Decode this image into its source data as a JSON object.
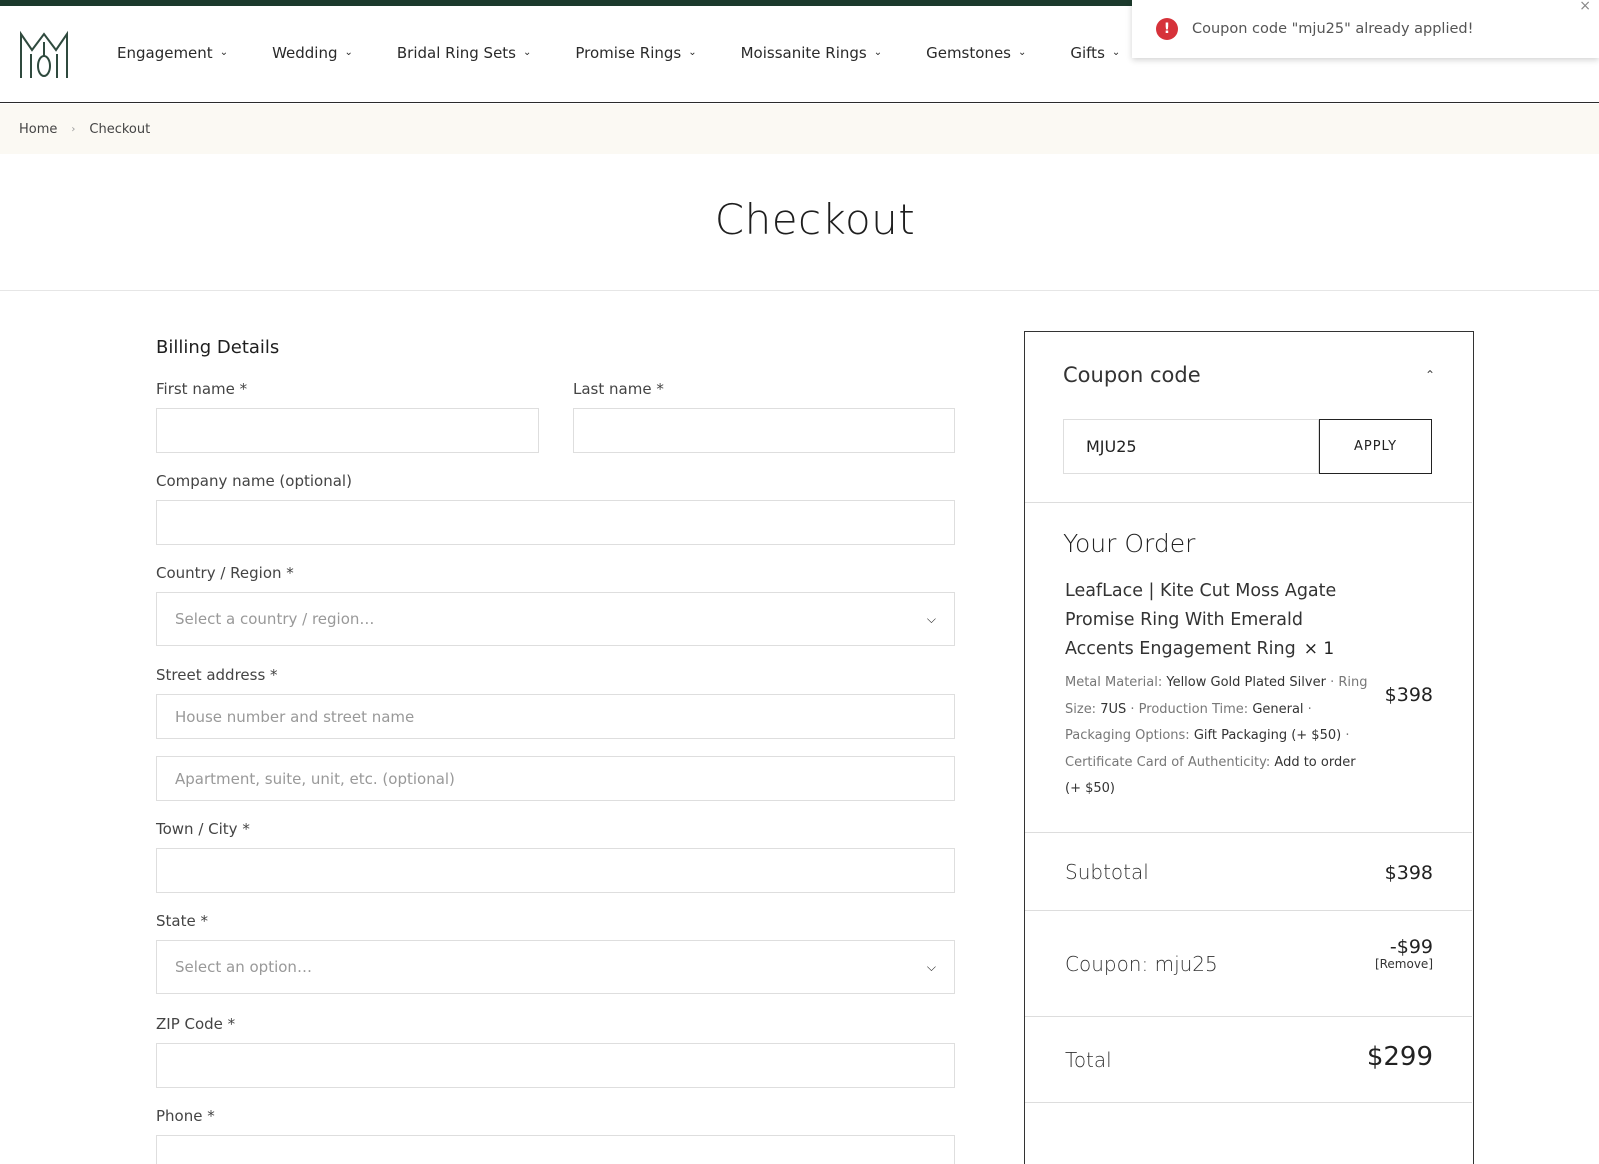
{
  "header": {
    "logo_alt": "MM",
    "nav": [
      {
        "label": "Engagement"
      },
      {
        "label": "Wedding"
      },
      {
        "label": "Bridal Ring Sets"
      },
      {
        "label": "Promise Rings"
      },
      {
        "label": "Moissanite Rings"
      },
      {
        "label": "Gemstones"
      },
      {
        "label": "Gifts"
      }
    ]
  },
  "toast": {
    "message": "Coupon code \"mju25\" already applied!",
    "icon": "!"
  },
  "breadcrumb": {
    "home": "Home",
    "current": "Checkout"
  },
  "page_title": "Checkout",
  "billing": {
    "heading": "Billing Details",
    "first_name_label": "First name *",
    "last_name_label": "Last name *",
    "company_label": "Company name (optional)",
    "country_label": "Country / Region *",
    "country_placeholder": "Select a country / region…",
    "street_label": "Street address *",
    "street_placeholder": "House number and street name",
    "apartment_placeholder": "Apartment, suite, unit, etc. (optional)",
    "city_label": "Town / City *",
    "state_label": "State *",
    "state_placeholder": "Select an option…",
    "zip_label": "ZIP Code *",
    "phone_label": "Phone *"
  },
  "summary": {
    "coupon_heading": "Coupon code",
    "coupon_value": "MJU25",
    "apply_label": "APPLY",
    "order_heading": "Your Order",
    "product": {
      "name": "LeafLace | Kite Cut Moss Agate Promise Ring With Emerald Accents Engagement Ring",
      "qty": "× 1",
      "price": "$398",
      "metal_label": "Metal Material:",
      "metal_value": "Yellow Gold Plated Silver",
      "size_label": "Ring Size:",
      "size_value": "7US",
      "production_label": "Production Time:",
      "production_value": "General",
      "packaging_label": "Packaging Options:",
      "packaging_value": "Gift Packaging (+ $50)",
      "certificate_label": "Certificate Card of Authenticity:",
      "certificate_value": "Add to order (+ $50)"
    },
    "subtotal_label": "Subtotal",
    "subtotal_value": "$398",
    "coupon_label": "Coupon: mju25",
    "coupon_discount": "-$99",
    "remove_label": "[Remove]",
    "total_label": "Total",
    "total_value": "$299"
  }
}
